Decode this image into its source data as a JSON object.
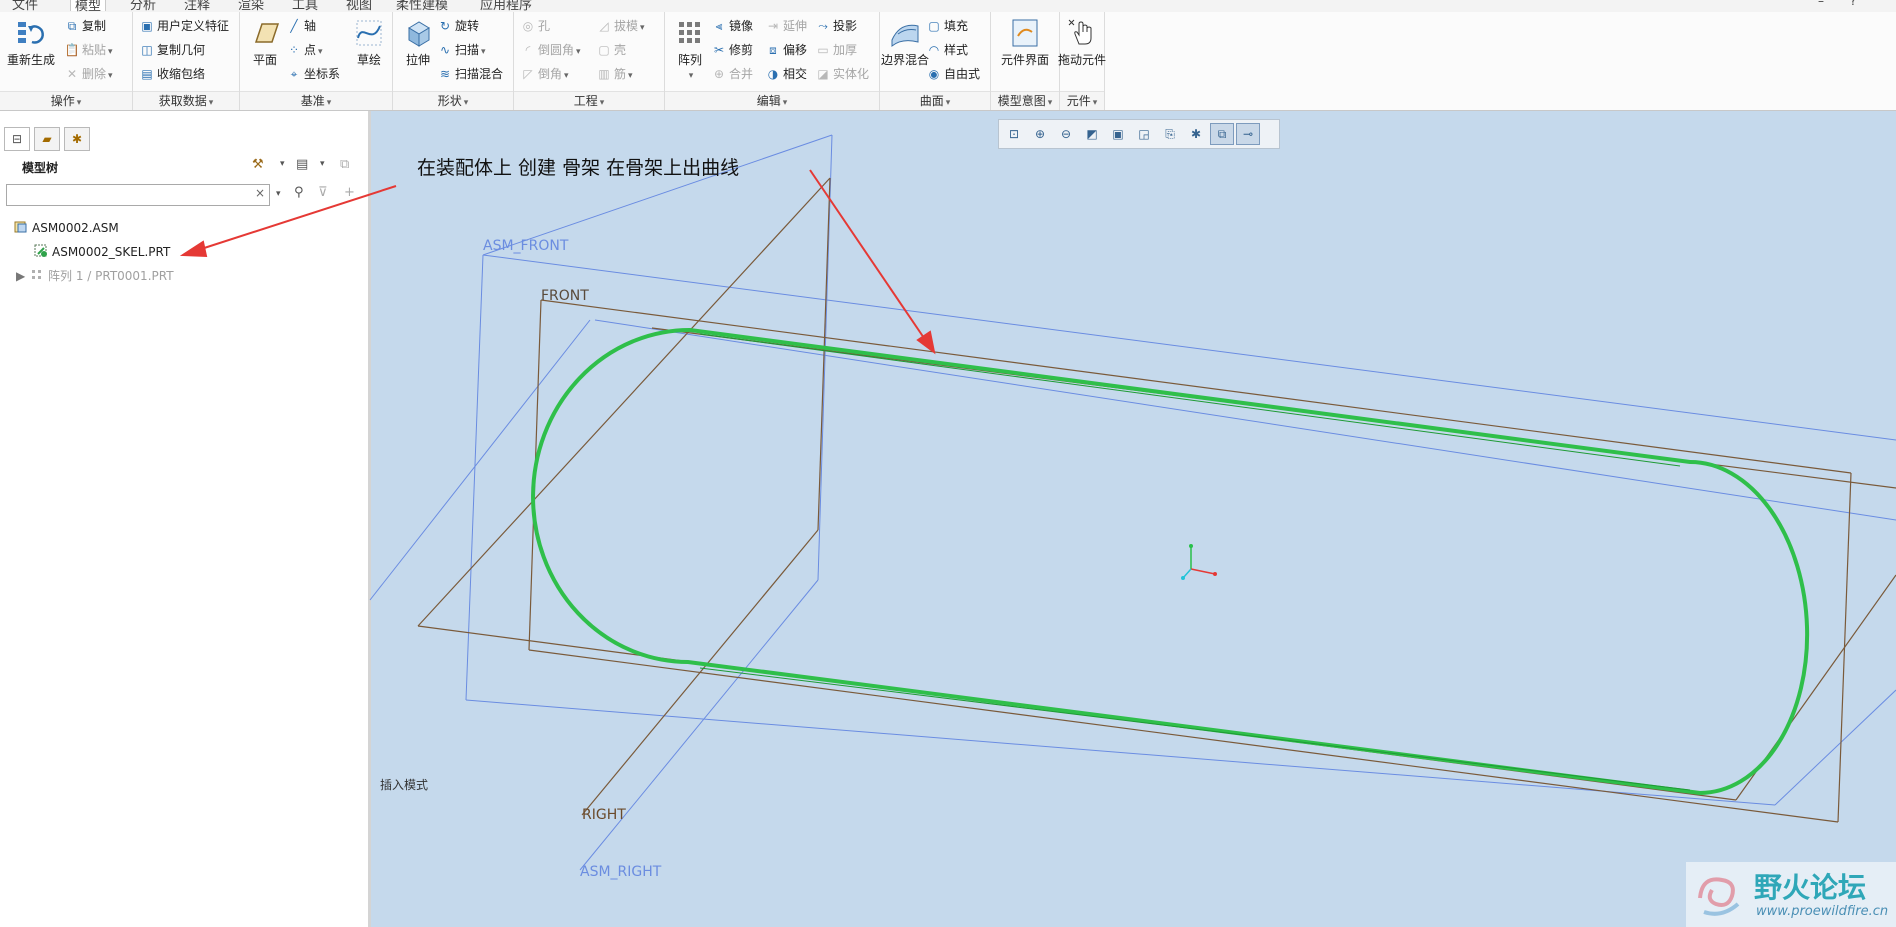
{
  "tabs": [
    "文件",
    "模型",
    "分析",
    "注释",
    "渲染",
    "工具",
    "视图",
    "柔性建模",
    "应用程序"
  ],
  "ribbon": {
    "operations": {
      "label": "操作",
      "regenerate": "重新生成",
      "copy": "复制",
      "paste": "粘贴",
      "delete": "删除"
    },
    "get_data": {
      "label": "获取数据",
      "udf": "用户定义特征",
      "copy_geometry": "复制几何",
      "shrinkwrap": "收缩包络"
    },
    "datum": {
      "label": "基准",
      "plane": "平面",
      "axis": "轴",
      "point": "点",
      "csys": "坐标系",
      "sketch": "草绘"
    },
    "shapes": {
      "label": "形状",
      "extrude": "拉伸",
      "revolve": "旋转",
      "sweep": "扫描",
      "swept_blend": "扫描混合"
    },
    "engineering": {
      "label": "工程",
      "hole": "孔",
      "round": "倒圆角",
      "chamfer": "倒角",
      "draft": "拔模",
      "shell": "壳",
      "rib": "筋"
    },
    "editing": {
      "label": "编辑",
      "pattern": "阵列",
      "mirror": "镜像",
      "trim": "修剪",
      "merge": "合并",
      "extend": "延伸",
      "offset": "偏移",
      "intersect": "相交",
      "project": "投影",
      "thicken": "加厚",
      "solidify": "实体化"
    },
    "surfaces": {
      "label": "曲面",
      "boundary_blend": "边界混合",
      "fill": "填充",
      "style": "样式",
      "freestyle": "自由式"
    },
    "model_intent": {
      "label": "模型意图",
      "component_interface": "元件界面"
    },
    "component": {
      "label": "元件",
      "drag_components": "拖动元件"
    }
  },
  "model_tree": {
    "title": "模型树",
    "search_value": "",
    "items": [
      {
        "label": "ASM0002.ASM"
      },
      {
        "label": "ASM0002_SKEL.PRT"
      },
      {
        "label": "阵列 1 / PRT0001.PRT"
      }
    ]
  },
  "viewport": {
    "annotation": "在装配体上 创建 骨架  在骨架上出曲线",
    "datum_labels": {
      "asm_front": "ASM_FRONT",
      "front": "FRONT",
      "right": "RIGHT",
      "asm_right": "ASM_RIGHT"
    },
    "status": "插入模式"
  },
  "watermark": {
    "title": "野火论坛",
    "url": "www.proewildfire.cn"
  },
  "colors": {
    "viewport_bg": "#c5d9ec",
    "curve": "#2fbf4a",
    "arrow": "#e53935",
    "asm_datum": "#5b7fe0",
    "part_datum": "#7a5a3a"
  },
  "icons": [
    "regenerate-icon",
    "copy-icon",
    "paste-icon",
    "delete-icon",
    "plane-icon",
    "axis-icon",
    "point-icon",
    "csys-icon",
    "sketch-icon",
    "extrude-icon",
    "revolve-icon",
    "sweep-icon",
    "pattern-icon",
    "mirror-icon",
    "boundary-blend-icon",
    "drag-icon",
    "zoom-icon",
    "repaint-icon"
  ]
}
